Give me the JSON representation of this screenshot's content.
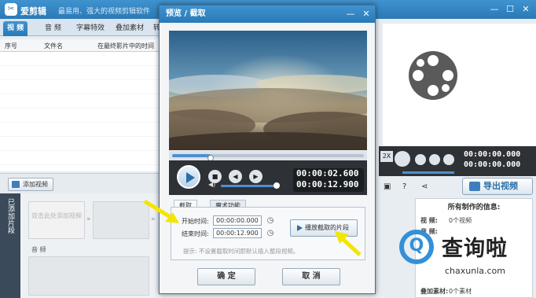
{
  "app": {
    "name": "爱剪辑",
    "slogan": "最易用、强大的视频剪辑软件",
    "min": "—",
    "max": "☐",
    "close": "✕"
  },
  "tabs": [
    {
      "label": "视 频"
    },
    {
      "label": "音 频"
    },
    {
      "label": "字幕特效"
    },
    {
      "label": "叠加素材"
    },
    {
      "label": "转"
    }
  ],
  "list": {
    "col_no": "序号",
    "col_file": "文件名",
    "col_pos": "在最终影片中的时间"
  },
  "add_video": "添加视频",
  "clips": {
    "side_label": "已添加片段",
    "placeholder": "双击此处添加视频",
    "audio_label": "音 频"
  },
  "right": {
    "time1": "00:00:00.000",
    "time2": "00:00:00.000",
    "speed": "2X",
    "export": "导出视频",
    "info_title": "所有制作的信息:",
    "info_rows": [
      {
        "k": "视  频:",
        "v": "0个视频"
      },
      {
        "k": "音  频:",
        "v": ""
      },
      {
        "k": "叠加素材:",
        "v": "0个素材"
      }
    ]
  },
  "dialog": {
    "title": "预览 / 截取",
    "minimize": "—",
    "close": "✕",
    "time_current": "00:00:02.600",
    "time_total": "00:00:12.900",
    "progress": 0.2,
    "volume": 0.95,
    "tab_cut": "截取",
    "tab_magic": "魔术功能",
    "start_label": "开始时间:",
    "start_value": "00:00:00.000",
    "end_label": "结束时间:",
    "end_value": "00:00:12.900",
    "play_clip": "播放截取的片段",
    "hint": "提示: 不设置截取时间即默认插入整段视频。",
    "ok": "确 定",
    "cancel": "取 消"
  },
  "watermark": {
    "text": "查询啦",
    "url": "chaxunla.com"
  },
  "colors": {
    "accent": "#2b79b7",
    "arrow": "#f2e600"
  }
}
